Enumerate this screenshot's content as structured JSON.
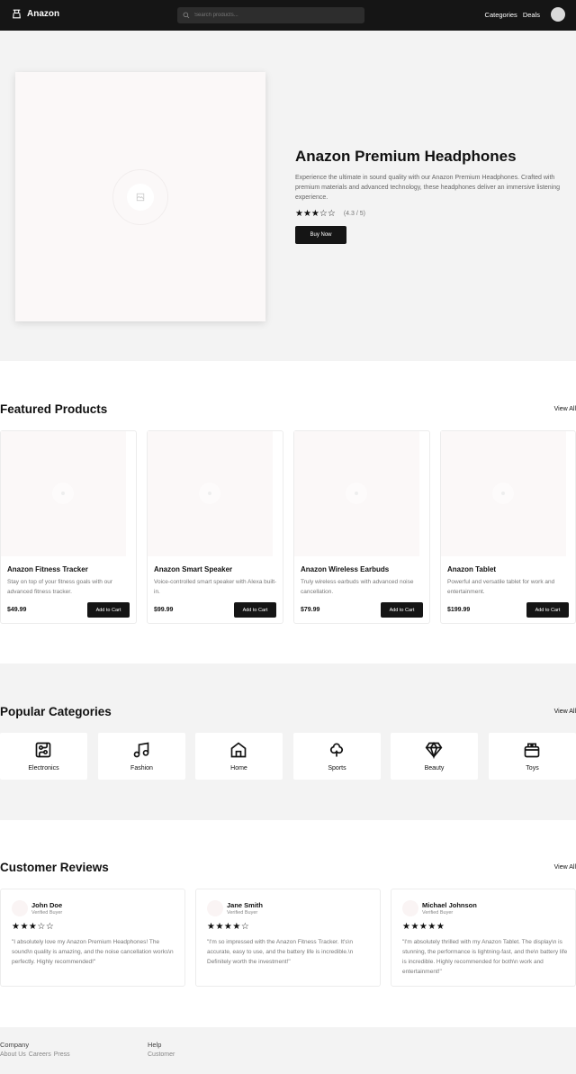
{
  "nav": {
    "brand": "Anazon",
    "search_placeholder": "Search products...",
    "links": [
      "Categories",
      "Deals"
    ]
  },
  "hero": {
    "title": "Anazon Premium Headphones",
    "description": "Experience the ultimate in sound quality with our Anazon Premium Headphones. Crafted with premium materials and advanced technology, these headphones deliver an immersive listening experience.",
    "rating": 3,
    "rating_max": 5,
    "rating_text": "(4.3 / 5)",
    "cta": "Buy Now"
  },
  "featured": {
    "title": "Featured Products",
    "view_all": "View All",
    "products": [
      {
        "name": "Anazon Fitness Tracker",
        "description": "Stay on top of your fitness goals with our advanced fitness tracker.",
        "price": "$49.99",
        "cta": "Add to Cart"
      },
      {
        "name": "Anazon Smart Speaker",
        "description": "Voice-controlled smart speaker with Alexa built-in.",
        "price": "$99.99",
        "cta": "Add to Cart"
      },
      {
        "name": "Anazon Wireless Earbuds",
        "description": "Truly wireless earbuds with advanced noise cancellation.",
        "price": "$79.99",
        "cta": "Add to Cart"
      },
      {
        "name": "Anazon Tablet",
        "description": "Powerful and versatile tablet for work and entertainment.",
        "price": "$199.99",
        "cta": "Add to Cart"
      }
    ]
  },
  "categories": {
    "title": "Popular Categories",
    "view_all": "View All",
    "items": [
      {
        "label": "Electronics",
        "icon": "circuit-board-icon"
      },
      {
        "label": "Fashion",
        "icon": "music-icon"
      },
      {
        "label": "Home",
        "icon": "home-icon"
      },
      {
        "label": "Sports",
        "icon": "clover-icon"
      },
      {
        "label": "Beauty",
        "icon": "gem-icon"
      },
      {
        "label": "Toys",
        "icon": "gift-box-icon"
      }
    ]
  },
  "reviews": {
    "title": "Customer Reviews",
    "view_all": "View All",
    "items": [
      {
        "name": "John Doe",
        "role": "Verified Buyer",
        "stars": 3,
        "text": "\"I absolutely love my Anazon Premium Headphones! The sound\\n quality is amazing, and the noise cancellation works\\n perfectly. Highly recommended!\""
      },
      {
        "name": "Jane Smith",
        "role": "Verified Buyer",
        "stars": 4,
        "text": "\"I'm so impressed with the Anazon Fitness Tracker. It's\\n accurate, easy to use, and the battery life is incredible.\\n Definitely worth the investment!\""
      },
      {
        "name": "Michael Johnson",
        "role": "Verified Buyer",
        "stars": 5,
        "text": "\"I'm absolutely thrilled with my Anazon Tablet. The display\\n is stunning, the performance is lightning-fast, and the\\n battery life is incredible. Highly recommended for both\\n work and entertainment!\""
      }
    ]
  },
  "footer": {
    "columns": [
      {
        "heading": "Company",
        "links": [
          "About Us",
          "Careers",
          "Press"
        ]
      },
      {
        "heading": "Help",
        "links": [
          "Customer"
        ]
      }
    ]
  },
  "colors": {
    "dark": "#151515",
    "light_bg": "#f3f3f3",
    "placeholder_bg": "#fbf8f8"
  }
}
